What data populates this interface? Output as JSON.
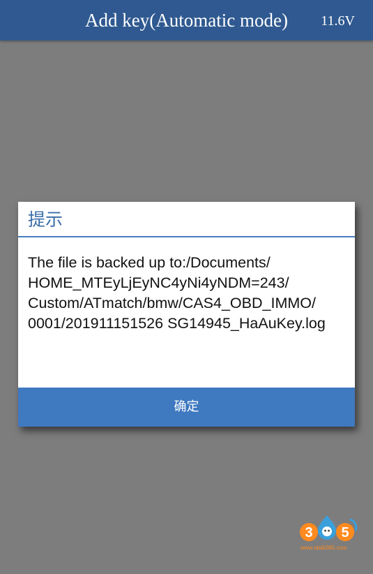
{
  "header": {
    "title": "Add key(Automatic mode)",
    "voltage": "11.6V"
  },
  "dialog": {
    "title": "提示",
    "message_lines": [
      "The file is backed up to:/Documents/",
      "HOME_MTEyLjEyNC4yNi4yNDM=243/",
      "Custom/ATmatch/bmw/CAS4_OBD_IMMO/",
      "0001/201911151526 SG14945_HaAuKey.log"
    ],
    "confirm_label": "确定"
  },
  "watermark": {
    "brand_digits": "305",
    "url": "www.obdii365.com"
  },
  "colors": {
    "header_bg": "#2f5990",
    "overlay_bg": "#7d7d7d",
    "dialog_title": "#3a6ea8",
    "confirm_button_bg": "#3f79c0",
    "watermark_orange": "#ff8a1f",
    "watermark_blue": "#3aa0dc"
  }
}
